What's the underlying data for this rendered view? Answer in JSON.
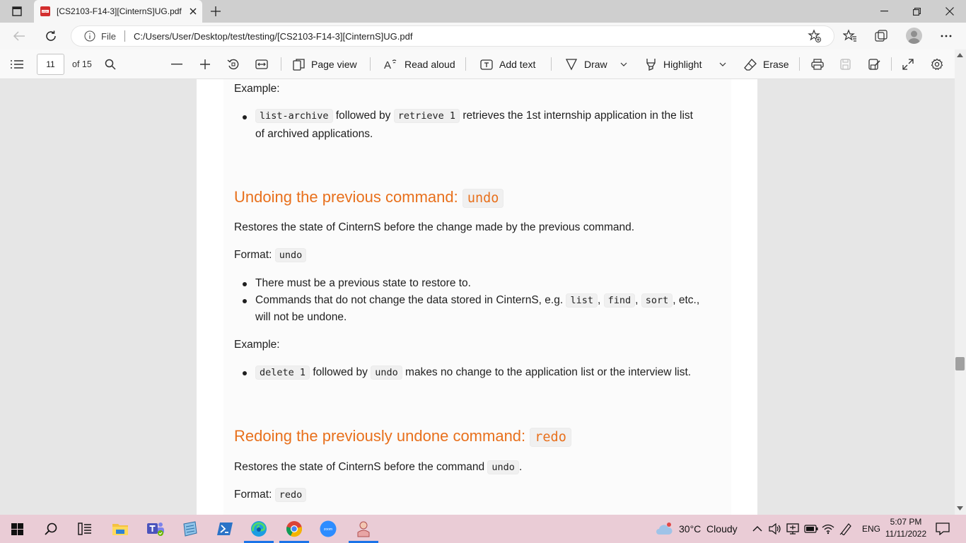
{
  "browser": {
    "tab_title": "[CS2103-F14-3][CinternS]UG.pdf",
    "file_label": "File",
    "url": "C:/Users/User/Desktop/test/testing/[CS2103-F14-3][CinternS]UG.pdf"
  },
  "pdf_toolbar": {
    "page_number": "11",
    "page_total": "of 15",
    "page_view_label": "Page view",
    "read_aloud_label": "Read aloud",
    "add_text_label": "Add text",
    "draw_label": "Draw",
    "highlight_label": "Highlight",
    "erase_label": "Erase"
  },
  "document": {
    "example1_label": "Example:",
    "example1_cmd1": "list-archive",
    "example1_mid": "followed by",
    "example1_cmd2": "retrieve 1",
    "example1_rest": "retrieves the 1st internship application in the list",
    "example1_line2": "of archived applications.",
    "undo_heading": "Undoing the previous command:",
    "undo_heading_code": "undo",
    "undo_desc": "Restores the state of CinternS before the change made by the previous command.",
    "undo_format_label": "Format:",
    "undo_format_code": "undo",
    "undo_bullet1": "There must be a previous state to restore to.",
    "undo_bullet2_pre": "Commands that do not change the data stored in CinternS, e.g.",
    "undo_bullet2_code1": "list",
    "undo_bullet2_comma1": ",",
    "undo_bullet2_code2": "find",
    "undo_bullet2_comma2": ",",
    "undo_bullet2_code3": "sort",
    "undo_bullet2_post": ", etc.,",
    "undo_bullet2_line2": "will not be undone.",
    "example2_label": "Example:",
    "example2_cmd1": "delete 1",
    "example2_mid": "followed by",
    "example2_cmd2": "undo",
    "example2_rest": "makes no change to the application list or the interview list.",
    "redo_heading": "Redoing the previously undone command:",
    "redo_heading_code": "redo",
    "redo_desc_pre": "Restores the state of CinternS before the command",
    "redo_desc_code": "undo",
    "redo_desc_post": ".",
    "redo_format_label": "Format:",
    "redo_format_code": "redo"
  },
  "taskbar": {
    "weather": "30°C  Cloudy",
    "language": "ENG",
    "time": "5:07 PM",
    "date": "11/11/2022",
    "zoom_label": "zoom"
  },
  "colors": {
    "heading": "#e8701c",
    "taskbar": "#eaccd6",
    "pdf_icon": "#d32f2f"
  }
}
